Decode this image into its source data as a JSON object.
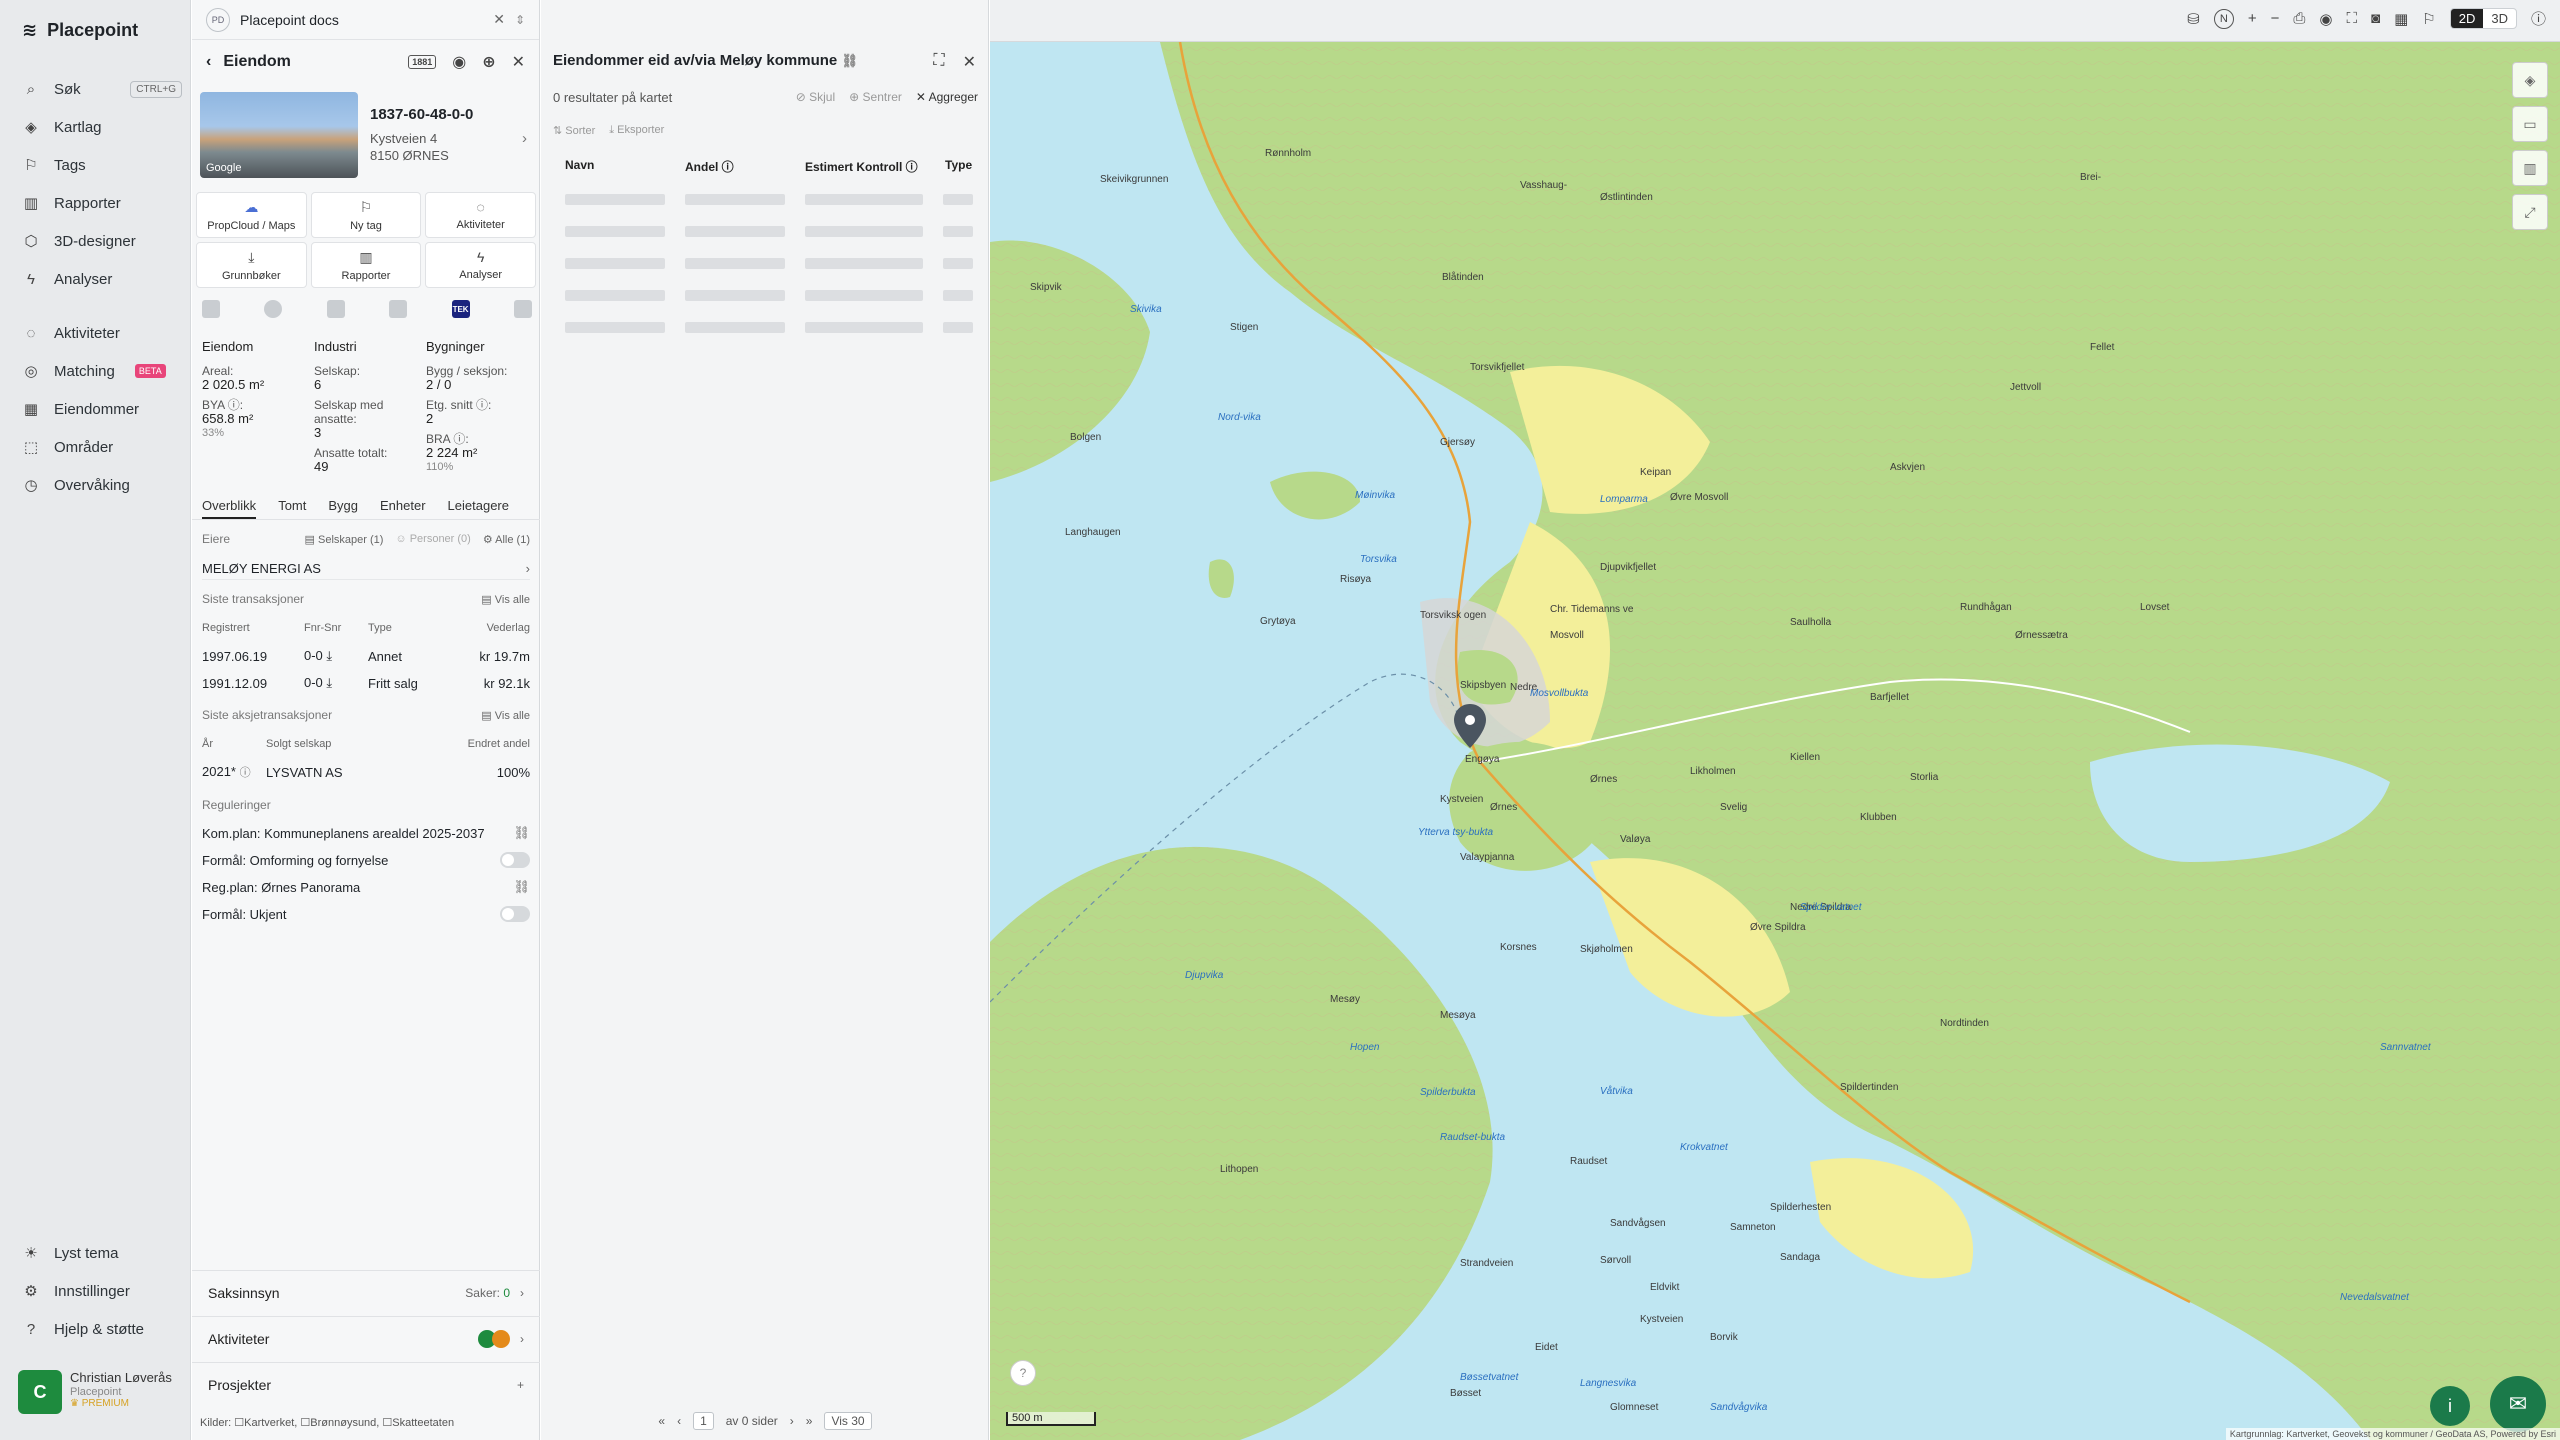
{
  "nav": {
    "brand": "Placepoint",
    "items": [
      {
        "label": "Søk",
        "icon": "search-icon",
        "shortcut": "CTRL+G"
      },
      {
        "label": "Kartlag",
        "icon": "layers-icon"
      },
      {
        "label": "Tags",
        "icon": "bookmark-icon"
      },
      {
        "label": "Rapporter",
        "icon": "chart-icon"
      },
      {
        "label": "3D-designer",
        "icon": "cube-icon"
      },
      {
        "label": "Analyser",
        "icon": "bolt-icon"
      },
      {
        "label": "Aktiviteter",
        "icon": "chat-icon"
      },
      {
        "label": "Matching",
        "icon": "target-icon",
        "badge": "BETA"
      },
      {
        "label": "Eiendommer",
        "icon": "building-icon"
      },
      {
        "label": "Områder",
        "icon": "area-icon"
      },
      {
        "label": "Overvåking",
        "icon": "watch-icon"
      }
    ],
    "bottom": [
      {
        "label": "Lyst tema",
        "icon": "sun-icon"
      },
      {
        "label": "Innstillinger",
        "icon": "gear-icon"
      },
      {
        "label": "Hjelp & støtte",
        "icon": "help-icon"
      }
    ],
    "user": {
      "initial": "C",
      "name": "Christian Løverås",
      "org": "Placepoint",
      "plan": "PREMIUM"
    }
  },
  "docs": {
    "badge": "PD",
    "title": "Placepoint docs"
  },
  "property": {
    "header": "Eiendom",
    "badge": "1881",
    "photo_credit": "Google",
    "id": "1837-60-48-0-0",
    "address_line1": "Kystveien 4",
    "address_line2": "8150 ØRNES",
    "actions": [
      {
        "label": "PropCloud / Maps",
        "icon": "cloud-icon"
      },
      {
        "label": "Ny tag",
        "icon": "bookmark-icon"
      },
      {
        "label": "Aktiviteter",
        "icon": "chat-icon"
      },
      {
        "label": "Grunnbøker",
        "icon": "download-icon"
      },
      {
        "label": "Rapporter",
        "icon": "chart-icon"
      },
      {
        "label": "Analyser",
        "icon": "bolt-icon"
      }
    ],
    "tek_label": "TEK",
    "facts": {
      "col1_title": "Eiendom",
      "areal_label": "Areal:",
      "areal_value": "2 020.5 m²",
      "bya_label": "BYA ⓘ:",
      "bya_value": "658.8 m²",
      "bya_pct": "33%",
      "col2_title": "Industri",
      "selskap_label": "Selskap:",
      "selskap_value": "6",
      "ansatte_label": "Selskap med ansatte:",
      "ansatte_value": "3",
      "ansatte_tot_label": "Ansatte totalt:",
      "ansatte_tot_value": "49",
      "col3_title": "Bygninger",
      "bygg_label": "Bygg / seksjon:",
      "bygg_value": "2 / 0",
      "etg_label": "Etg. snitt ⓘ:",
      "etg_value": "2",
      "bra_label": "BRA ⓘ:",
      "bra_value": "2 224 m²",
      "bra_pct": "110%"
    },
    "tabs": [
      "Overblikk",
      "Tomt",
      "Bygg",
      "Enheter",
      "Leietagere"
    ],
    "owners": {
      "label": "Eiere",
      "filters": [
        "Selskaper (1)",
        "Personer (0)",
        "Alle (1)"
      ],
      "owner": "MELØY ENERGI AS"
    },
    "transactions": {
      "title": "Siste transaksjoner",
      "show_all": "Vis alle",
      "headers": [
        "Registrert",
        "Fnr-Snr",
        "Type",
        "Vederlag"
      ],
      "rows": [
        {
          "date": "1997.06.19",
          "fnr": "0-0",
          "type": "Annet",
          "amount": "kr 19.7m"
        },
        {
          "date": "1991.12.09",
          "fnr": "0-0",
          "type": "Fritt salg",
          "amount": "kr 92.1k"
        }
      ]
    },
    "stock": {
      "title": "Siste aksjetransaksjoner",
      "show_all": "Vis alle",
      "headers": [
        "År",
        "Solgt selskap",
        "Endret andel"
      ],
      "row": {
        "year": "2021*",
        "company": "LYSVATN AS",
        "share": "100%"
      }
    },
    "regulations": {
      "title": "Reguleringer",
      "items": [
        {
          "label": "Kom.plan: Kommuneplanens arealdel 2025-2037"
        },
        {
          "label": "Formål: Omforming og fornyelse"
        },
        {
          "label": "Reg.plan: Ørnes Panorama"
        },
        {
          "label": "Formål: Ukjent"
        }
      ]
    },
    "bottom": {
      "saksinnsyn": "Saksinnsyn",
      "saker_label": "Saker:",
      "saker_value": "0",
      "aktiviteter": "Aktiviteter",
      "prosjekter": "Prosjekter"
    },
    "sources_label": "Kilder:",
    "sources": [
      "Kartverket",
      "Brønnøysund",
      "Skatteetaten"
    ]
  },
  "owned": {
    "title": "Eiendommer eid av/via Meløy kommune",
    "results": "0 resultater på kartet",
    "actions": [
      "Skjul",
      "Sentrer",
      "Aggreger"
    ],
    "sub_actions": [
      "Sorter",
      "Eksporter"
    ],
    "columns": [
      "Navn",
      "Andel ⓘ",
      "Estimert Kontroll ⓘ",
      "Type"
    ],
    "skeleton_rows": 5,
    "pager": {
      "page": "1",
      "of": "av 0 sider",
      "per_page": "Vis 30"
    }
  },
  "map": {
    "scale": "500 m",
    "attribution": "Kartgrunnlag: Kartverket, Geovekst og kommuner / GeoData AS, Powered by Esri",
    "modes": [
      "2D",
      "3D"
    ],
    "labels": [
      "Skeivikgrunnen",
      "Rønnholm",
      "Vasshaug-",
      "Østlintinden",
      "Blåtinden",
      "Skipvik",
      "Skivika",
      "Nord-vika",
      "Bolgen",
      "Stigen",
      "Torsvikfjellet",
      "Gjersøy",
      "Møinvika",
      "Langhaugen",
      "Risøya",
      "Grytøya",
      "Torsvika",
      "Torsviksk ogen",
      "Chr. Tidemanns ve",
      "Mosvoll",
      "Nedre",
      "Skipsbyen",
      "Mosvollbukta",
      "Ørnes",
      "Likholmen",
      "Kystveien",
      "Engøya",
      "Ytterva tsy-bukta",
      "Valaypjanna",
      "Valøya",
      "Djupvika",
      "Mesøy",
      "Hopen",
      "Lithopen",
      "Mesøya",
      "Skjøholmen",
      "Korsnes",
      "Spilderbukta",
      "Raudset-bukta",
      "Raudset",
      "Våtvika",
      "Krokvatnet",
      "Sandvågsen",
      "Sørvoll",
      "Eldvikt",
      "Strandveien",
      "Kystveien",
      "Borvik",
      "Eidet",
      "Bøsset",
      "Bøssetvatnet",
      "Langnesvika",
      "Glomneset",
      "Sandvågvika",
      "Samneton",
      "Sandaga",
      "Spildertinden",
      "Nordtinden",
      "Spilderhesten",
      "Nedre Spildra",
      "Øvre Spildra",
      "Spilder-vatnet",
      "Svelig",
      "Kiellen",
      "Rundhågan",
      "Storlia",
      "Klubben",
      "Barfjellet",
      "Ørnessætra",
      "Lovset",
      "Djupvikfjellet",
      "Saulholla",
      "Lomparma",
      "Øvre Mosvoll",
      "Askvjen",
      "Keipan",
      "Brei-",
      "Fellet",
      "Jettvoll",
      "Nevedalsvatnet",
      "Sannvatnet",
      "Ørnes"
    ]
  }
}
